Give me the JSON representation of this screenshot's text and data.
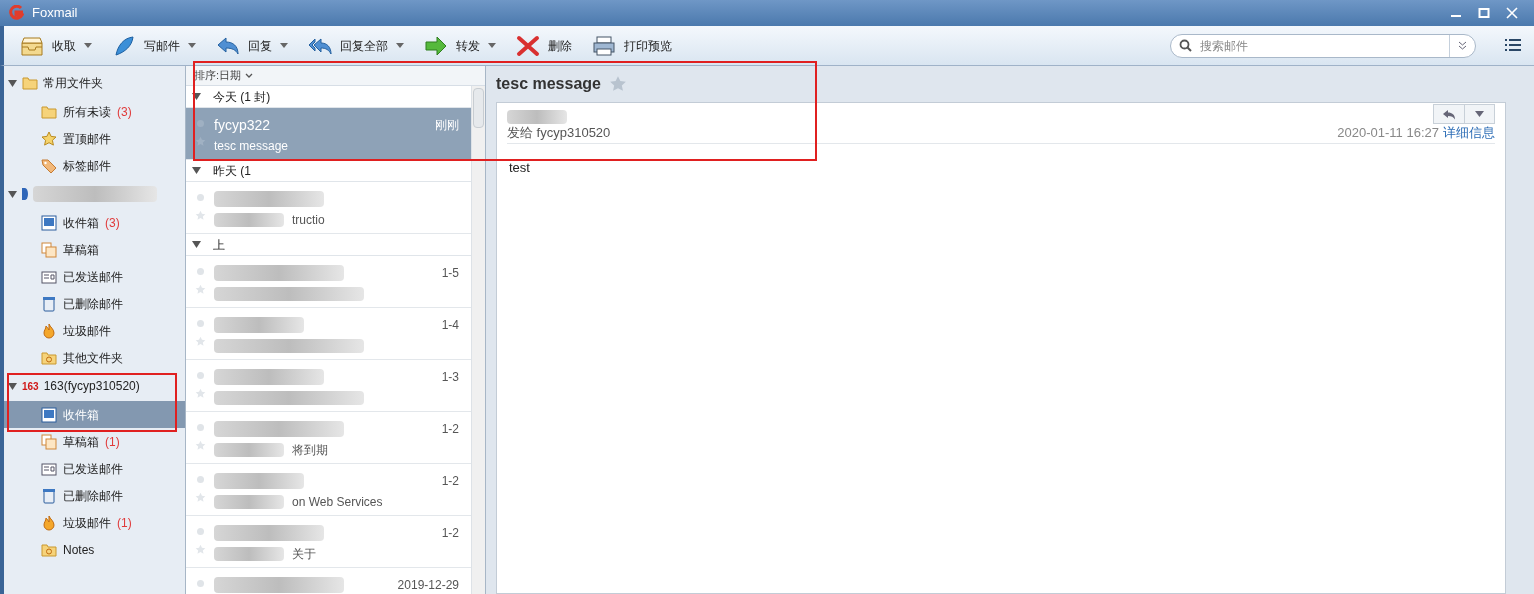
{
  "window": {
    "title": "Foxmail"
  },
  "toolbar": [
    {
      "label": "收取",
      "kind": "receive",
      "menu": true
    },
    {
      "label": "写邮件",
      "kind": "compose",
      "menu": true
    },
    {
      "label": "回复",
      "kind": "reply",
      "menu": true
    },
    {
      "label": "回复全部",
      "kind": "replyall",
      "menu": true
    },
    {
      "label": "转发",
      "kind": "forward",
      "menu": true
    },
    {
      "label": "删除",
      "kind": "delete",
      "menu": false
    },
    {
      "label": "打印预览",
      "kind": "print",
      "menu": false
    }
  ],
  "search": {
    "placeholder": "搜索邮件"
  },
  "sidebar": [
    {
      "label": "常用文件夹",
      "kind": "folder",
      "redacted": false,
      "expanded": true,
      "children": [
        {
          "label": "所有未读",
          "kind": "folder",
          "count": "(3)",
          "selected": false
        },
        {
          "label": "置顶邮件",
          "kind": "star",
          "selected": false
        },
        {
          "label": "标签邮件",
          "kind": "tag",
          "selected": false
        }
      ]
    },
    {
      "kind": "account",
      "redacted": true,
      "expanded": true,
      "children": [
        {
          "label": "收件箱",
          "kind": "inbox",
          "count": "(3)",
          "selected": false
        },
        {
          "label": "草稿箱",
          "kind": "drafts",
          "selected": false
        },
        {
          "label": "已发送邮件",
          "kind": "sent",
          "selected": false
        },
        {
          "label": "已删除邮件",
          "kind": "trash",
          "selected": false
        },
        {
          "label": "垃圾邮件",
          "kind": "spam",
          "selected": false
        },
        {
          "label": "其他文件夹",
          "kind": "other",
          "selected": false
        }
      ]
    },
    {
      "label": "163(fycyp310520)",
      "kind": "account163",
      "badge": "163",
      "redacted": false,
      "expanded": true,
      "children": [
        {
          "label": "收件箱",
          "kind": "inbox",
          "selected": true
        },
        {
          "label": "草稿箱",
          "kind": "drafts",
          "count": "(1)",
          "selected": false
        },
        {
          "label": "已发送邮件",
          "kind": "sent",
          "selected": false
        },
        {
          "label": "已删除邮件",
          "kind": "trash",
          "selected": false
        },
        {
          "label": "垃圾邮件",
          "kind": "spam",
          "count": "(1)",
          "selected": false
        },
        {
          "label": "Notes",
          "kind": "other",
          "selected": false
        }
      ]
    }
  ],
  "message_list": {
    "sort": "排序:日期",
    "groups": [
      {
        "label": "今天 (1 封)",
        "expanded": true,
        "messages": [
          {
            "sender": "fycyp322",
            "subject": "tesc message",
            "time": "刚刚",
            "selected": true,
            "redacted": false
          }
        ]
      },
      {
        "label": "昨天 (1",
        "expanded": true,
        "messages": [
          {
            "subject": "tructio",
            "selected": false,
            "redacted": true
          }
        ]
      },
      {
        "label": "上",
        "expanded": true,
        "messages": [
          {
            "time": "1-5",
            "selected": false,
            "redacted": true
          },
          {
            "time": "1-4",
            "selected": false,
            "redacted": true
          },
          {
            "time": "1-3",
            "selected": false,
            "redacted": true
          },
          {
            "subject": "将到期",
            "time": "1-2",
            "selected": false,
            "redacted": true
          },
          {
            "subject": "on Web Services",
            "time": "1-2",
            "selected": false,
            "redacted": true
          },
          {
            "subject": "关于",
            "time": "1-2",
            "selected": false,
            "redacted": true
          },
          {
            "time": "2019-12-29",
            "selected": false,
            "redacted": true
          }
        ]
      }
    ]
  },
  "reader": {
    "subject": "tesc message",
    "starred": false,
    "to": "发给 fycyp310520",
    "date": "2020-01-11 16:27",
    "details_link": "详细信息",
    "body": "test"
  }
}
